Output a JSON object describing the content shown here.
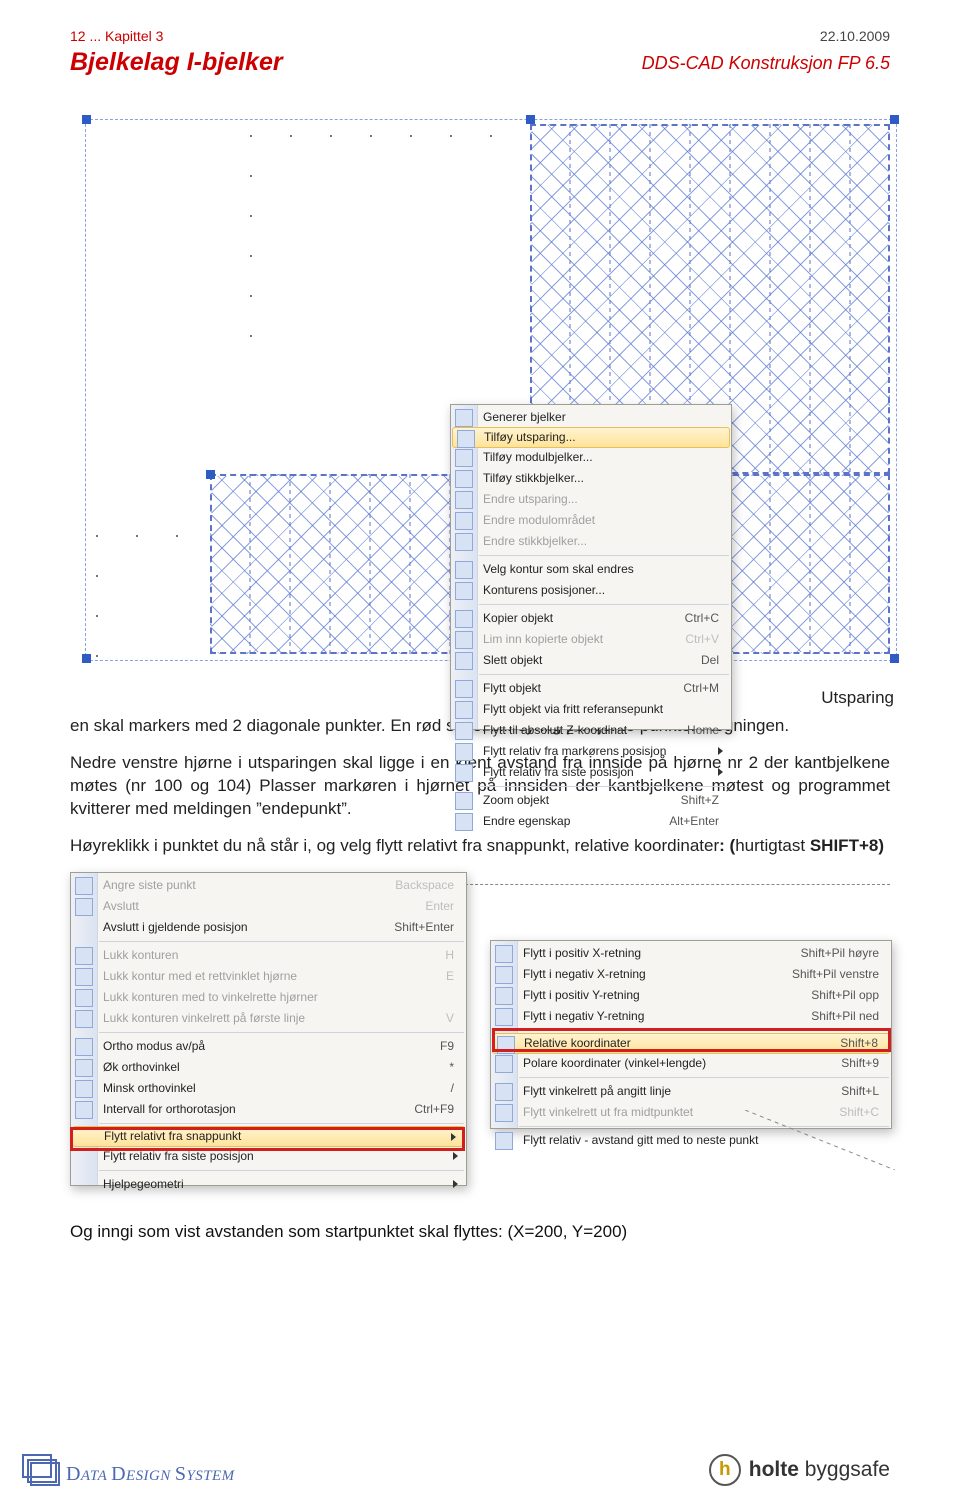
{
  "header": {
    "chapter": "12 ... Kapittel 3",
    "date": "22.10.2009",
    "title": "Bjelkelag I-bjelker",
    "product": "DDS-CAD Konstruksjon  FP  6.5"
  },
  "menu1": [
    {
      "icon": "generer",
      "label": "Generer bjelker"
    },
    {
      "icon": "plus",
      "label": "Tilføy utsparing...",
      "highlight": true
    },
    {
      "icon": "modul",
      "label": "Tilføy modulbjelker..."
    },
    {
      "icon": "stikk",
      "label": "Tilføy stikkbjelker..."
    },
    {
      "icon": "edit",
      "label": "Endre utsparing...",
      "disabled": true
    },
    {
      "icon": "edit",
      "label": "Endre modulområdet",
      "disabled": true
    },
    {
      "icon": "edit",
      "label": "Endre stikkbjelker...",
      "disabled": true
    },
    {
      "sep": true
    },
    {
      "icon": "contour",
      "label": "Velg kontur som skal endres"
    },
    {
      "icon": "pos",
      "label": "Konturens posisjoner..."
    },
    {
      "sep": true
    },
    {
      "icon": "copy",
      "label": "Kopier objekt",
      "shortcut": "Ctrl+C"
    },
    {
      "icon": "paste",
      "label": "Lim inn kopierte objekt",
      "shortcut": "Ctrl+V",
      "disabled": true
    },
    {
      "icon": "del",
      "label": "Slett objekt",
      "shortcut": "Del"
    },
    {
      "sep": true
    },
    {
      "icon": "move",
      "label": "Flytt objekt",
      "shortcut": "Ctrl+M"
    },
    {
      "icon": "moveref",
      "label": "Flytt objekt via fritt referansepunkt"
    },
    {
      "icon": "z",
      "label": "Flytt til absolutt Z-koordinat",
      "shortcut": "Home"
    },
    {
      "icon": "arrow",
      "label": "Flytt relativ fra markørens posisjon",
      "submenu": true
    },
    {
      "icon": "arrow",
      "label": "Flytt relativ fra siste posisjon",
      "submenu": true
    },
    {
      "sep": true
    },
    {
      "icon": "zoom",
      "label": "Zoom objekt",
      "shortcut": "Shift+Z"
    },
    {
      "icon": "prop",
      "label": "Endre egenskap",
      "shortcut": "Alt+Enter"
    }
  ],
  "menuA": [
    {
      "icon": "undo",
      "label": "Angre siste punkt",
      "shortcut": "Backspace",
      "disabled": true
    },
    {
      "icon": "ok",
      "label": "Avslutt",
      "shortcut": "Enter",
      "disabled": true
    },
    {
      "label": "Avslutt i gjeldende posisjon",
      "shortcut": "Shift+Enter"
    },
    {
      "sep": true
    },
    {
      "icon": "close",
      "label": "Lukk konturen",
      "shortcut": "H",
      "disabled": true
    },
    {
      "icon": "close90",
      "label": "Lukk kontur med et rettvinklet hjørne",
      "shortcut": "E",
      "disabled": true
    },
    {
      "icon": "close2",
      "label": "Lukk konturen med to vinkelrette hjørner",
      "disabled": true
    },
    {
      "icon": "closeL",
      "label": "Lukk konturen vinkelrett på første linje",
      "shortcut": "V",
      "disabled": true
    },
    {
      "sep": true
    },
    {
      "icon": "ortho",
      "label": "Ortho modus av/på",
      "shortcut": "F9"
    },
    {
      "icon": "ang",
      "label": "Øk orthovinkel",
      "shortcut": "*"
    },
    {
      "icon": "ang",
      "label": "Minsk orthovinkel",
      "shortcut": "/"
    },
    {
      "icon": "rot",
      "label": "Intervall for orthorotasjon",
      "shortcut": "Ctrl+F9"
    },
    {
      "sep": true
    },
    {
      "label": "Flytt relativt fra snappunkt",
      "submenu": true,
      "highlight": true
    },
    {
      "label": "Flytt relativ fra siste posisjon",
      "submenu": true
    },
    {
      "sep": true
    },
    {
      "label": "Hjelpegeometri",
      "submenu": true
    }
  ],
  "menuB": [
    {
      "icon": "px",
      "label": "Flytt i positiv X-retning",
      "shortcut": "Shift+Pil høyre"
    },
    {
      "icon": "nx",
      "label": "Flytt i negativ X-retning",
      "shortcut": "Shift+Pil venstre"
    },
    {
      "icon": "py",
      "label": "Flytt i positiv Y-retning",
      "shortcut": "Shift+Pil opp"
    },
    {
      "icon": "ny",
      "label": "Flytt i negativ Y-retning",
      "shortcut": "Shift+Pil ned"
    },
    {
      "sep": true
    },
    {
      "icon": "rel",
      "label": "Relative koordinater",
      "shortcut": "Shift+8",
      "highlight": true
    },
    {
      "icon": "pol",
      "label": "Polare koordinater (vinkel+lengde)",
      "shortcut": "Shift+9"
    },
    {
      "sep": true
    },
    {
      "icon": "perp",
      "label": "Flytt vinkelrett på angitt linje",
      "shortcut": "Shift+L"
    },
    {
      "icon": "mid",
      "label": "Flytt vinkelrett ut fra midtpunktet",
      "shortcut": "Shift+C",
      "disabled": true
    },
    {
      "sep": true
    },
    {
      "icon": "dist",
      "label": "Flytt relativ - avstand gitt med to neste punkt"
    }
  ],
  "text": {
    "intro_tail": "Utsparing en skal markers med 2 diagonale punkter. En rød sirkel blir synlig på kjente punkter i tegningen.",
    "p1": "Nedre venstre hjørne i utsparingen skal ligge i en kjent avstand fra innside på hjørne nr 2 der kantbjelkene møtes (nr 100 og 104) Plasser markøren i hjørnet på innsiden der kantbjelkene møtest og programmet kvitterer med meldingen ”endepunkt”.",
    "p2a": "Høyreklikk i punktet du nå står i, og velg flytt relativt fra snappunkt, relative koordinater",
    "p2b": ": (",
    "p2c": "hurtigtast ",
    "p2d": "SHIFT+8)",
    "final": "Og inngi som vist avstanden som startpunktet skal flyttes: (X=200, Y=200)"
  },
  "footer": {
    "dds": {
      "big": "D",
      "rest_sc": "ATA ",
      "big2": "D",
      "rest_sc2": "ESIGN ",
      "big3": "S",
      "rest_sc3": "YSTEM"
    },
    "holte": {
      "logo": "h",
      "brand_bold": "holte",
      "brand_rest": " byggsafe"
    }
  }
}
